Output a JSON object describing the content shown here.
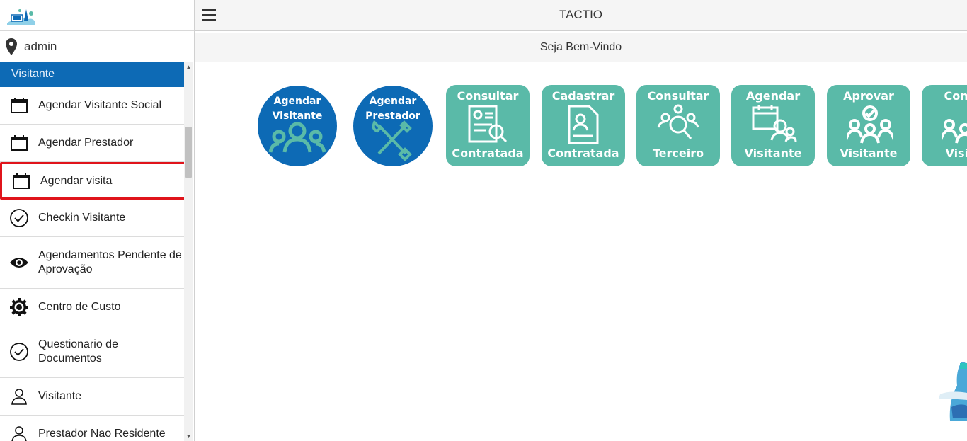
{
  "header": {
    "title": "TACTIO",
    "welcome": "Seja Bem-Vindo"
  },
  "sidebar": {
    "user": "admin",
    "section": "Visitante",
    "items": [
      {
        "label": "Agendar Visitante Social",
        "icon": "calendar-icon"
      },
      {
        "label": "Agendar Prestador",
        "icon": "calendar-icon"
      },
      {
        "label": "Agendar visita",
        "icon": "calendar-icon",
        "selected": true
      },
      {
        "label": "Checkin Visitante",
        "icon": "check-circle-icon"
      },
      {
        "label": "Agendamentos Pendente de Aprovação",
        "icon": "eye-icon"
      },
      {
        "label": "Centro de Custo",
        "icon": "gear-icon"
      },
      {
        "label": "Questionario de Documentos",
        "icon": "check-circle-icon"
      },
      {
        "label": "Visitante",
        "icon": "person-icon"
      },
      {
        "label": "Prestador Nao Residente",
        "icon": "person-icon"
      }
    ]
  },
  "tiles": [
    {
      "top": "Agendar",
      "bottom": "Visitante",
      "style": "circle",
      "icon": "people-icon"
    },
    {
      "top": "Agendar",
      "bottom": "Prestador",
      "style": "circle",
      "icon": "tools-icon"
    },
    {
      "top": "Consultar",
      "bottom": "Contratada",
      "style": "rect",
      "icon": "document-search-icon"
    },
    {
      "top": "Cadastrar",
      "bottom": "Contratada",
      "style": "rect",
      "icon": "document-person-icon"
    },
    {
      "top": "Consultar",
      "bottom": "Terceiro",
      "style": "rect",
      "icon": "people-search-icon"
    },
    {
      "top": "Agendar",
      "bottom": "Visitante",
      "style": "rect",
      "icon": "calendar-people-icon"
    },
    {
      "top": "Aprovar",
      "bottom": "Visitante",
      "style": "rect",
      "icon": "people-check-icon"
    },
    {
      "top": "Consu",
      "bottom": "Visita",
      "style": "rect",
      "icon": "people-search-icon"
    }
  ],
  "colors": {
    "primary": "#0d6ab5",
    "tile": "#5abaa8",
    "highlight": "#e0141b"
  }
}
